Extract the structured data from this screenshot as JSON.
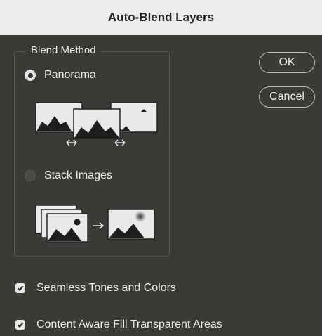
{
  "window": {
    "title": "Auto-Blend Layers"
  },
  "blend_method": {
    "legend": "Blend Method",
    "options": [
      {
        "label": "Panorama",
        "selected": true
      },
      {
        "label": "Stack Images",
        "selected": false
      }
    ]
  },
  "buttons": {
    "ok": "OK",
    "cancel": "Cancel"
  },
  "checkboxes": [
    {
      "label": "Seamless Tones and Colors",
      "checked": true
    },
    {
      "label": "Content Aware Fill Transparent Areas",
      "checked": true
    }
  ],
  "icons": {
    "panorama": "panorama-illustration-icon",
    "stack": "stack-images-illustration-icon",
    "checkmark": "checkmark-icon"
  }
}
